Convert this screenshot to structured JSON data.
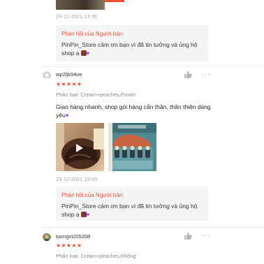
{
  "review1": {
    "date": "24-12-2021 13:36",
    "reply_title": "Phản hồi của Người bán:",
    "reply_text": "PinPin_Store cảm ơn bạn vì đã tin tưởng và ủng hộ shop ạ"
  },
  "review2": {
    "username": "wp2ljk94oe",
    "stars": "★★★★★",
    "variant": "Phân loại: Cream+peaches,Poster",
    "comment": "Giao hàng nhanh, shop gói hàng cẩn thận, thân thiện dáng yêu",
    "date": "23-12-2021 19:09",
    "reply_title": "Phản hồi của Người bán:",
    "reply_text": "PinPin_Store cảm ơn bạn vì đã tin tưởng và ủng hộ shop ạ"
  },
  "review3": {
    "username": "tuongvi205208",
    "stars": "★★★★★",
    "variant": "Phân loại: Cream+peaches,Không"
  },
  "icons": {
    "like": "thumbs-up-icon",
    "more": "more-options-icon",
    "heart": "purple-heart-emoji",
    "bag": "shopping-bag-emoji"
  },
  "colors": {
    "accent": "#ee4d2d",
    "star": "#ee4d2d",
    "heart": "#9b37ff"
  },
  "more_glyph": "···"
}
